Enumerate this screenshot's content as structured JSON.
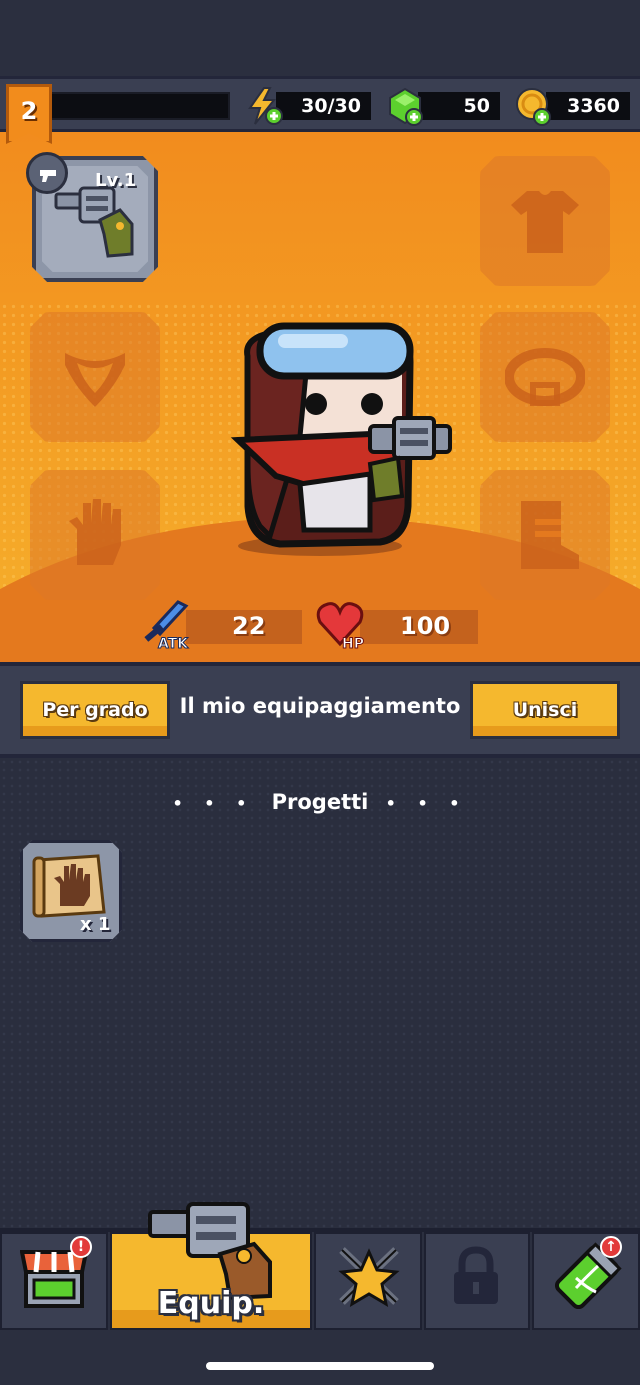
{
  "player": {
    "level": "2"
  },
  "resources": [
    {
      "name": "energy",
      "icon": "lightning-icon",
      "value": "30/30"
    },
    {
      "name": "gems",
      "icon": "gem-icon",
      "value": "50"
    },
    {
      "name": "coins",
      "icon": "coin-icon",
      "value": "3360"
    }
  ],
  "equipped_weapon": {
    "level_label": "Lv.1",
    "icon": "revolver-icon"
  },
  "empty_slots": [
    "armor-slot",
    "necklace-slot",
    "belt-slot",
    "gloves-slot",
    "boots-slot"
  ],
  "stats": {
    "atk": {
      "label": "ATK",
      "value": "22"
    },
    "hp": {
      "label": "HP",
      "value": "100"
    }
  },
  "actions": {
    "sort_label": "Per grado",
    "title": "Il mio equipaggiamento",
    "merge_label": "Unisci"
  },
  "inventory": {
    "section_title": "Progetti",
    "items": [
      {
        "icon": "gloves-blueprint-icon",
        "qty": "x 1"
      }
    ]
  },
  "nav": {
    "items": [
      {
        "name": "shop",
        "icon": "shop-icon",
        "badge": "!"
      },
      {
        "name": "equip",
        "label": "Equip.",
        "active": true
      },
      {
        "name": "battle",
        "icon": "swords-star-icon"
      },
      {
        "name": "locked",
        "icon": "lock-icon"
      },
      {
        "name": "evolve",
        "icon": "dna-capsule-icon",
        "badge": "↑"
      }
    ]
  },
  "colors": {
    "accent": "#f5b82e",
    "hero_bg": "#f28c1e",
    "panel": "#3a3f52",
    "bg": "#2b2f3f"
  }
}
